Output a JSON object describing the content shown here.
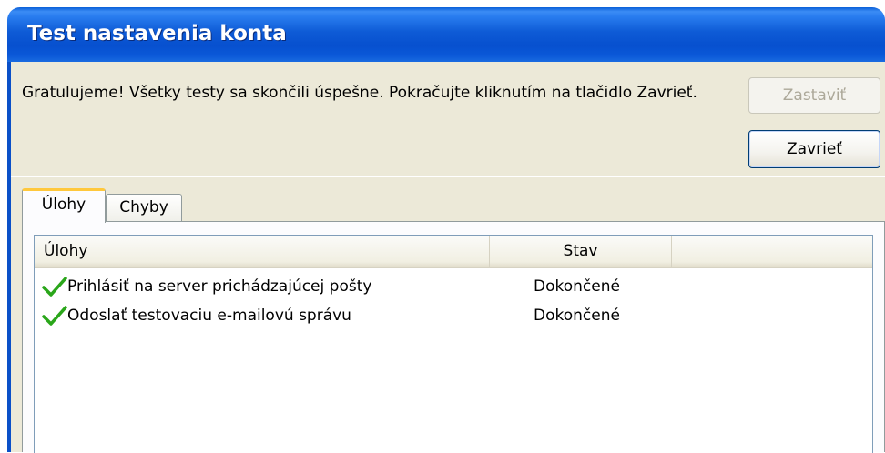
{
  "window": {
    "title": "Test nastavenia konta"
  },
  "message": "Gratulujeme! Všetky testy sa skončili úspešne. Pokračujte kliknutím na tlačidlo Zavrieť.",
  "buttons": {
    "stop_label": "Zastaviť",
    "stop_enabled": false,
    "close_label": "Zavrieť"
  },
  "tabs": [
    {
      "label": "Úlohy",
      "selected": true
    },
    {
      "label": "Chyby",
      "selected": false
    }
  ],
  "list": {
    "columns": [
      "Úlohy",
      "Stav"
    ],
    "rows": [
      {
        "icon": "green-check-icon",
        "task": "Prihlásiť na server prichádzajúcej pošty",
        "status": "Dokončené"
      },
      {
        "icon": "green-check-icon",
        "task": "Odoslať testovaciu e-mailovú správu",
        "status": "Dokončené"
      }
    ]
  },
  "colors": {
    "titlebar": "#0a58d8",
    "client_background": "#ece9d8",
    "check": "#2aa61a",
    "selected_tab_accent": "#ffc83c"
  }
}
